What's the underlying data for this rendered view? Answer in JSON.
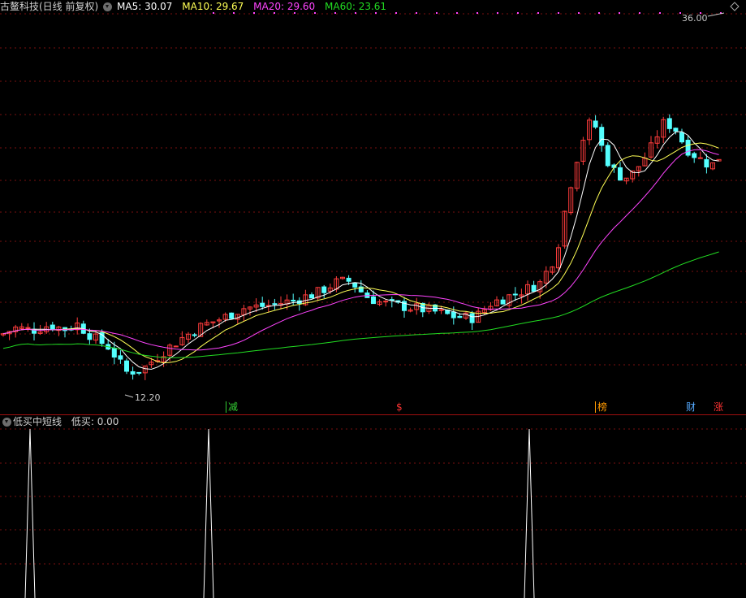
{
  "header": {
    "title": "古鳌科技(日线 前复权)",
    "ma": [
      {
        "label": "MA5: 30.07",
        "color": "#ffffff"
      },
      {
        "label": "MA10: 29.67",
        "color": "#ffff55"
      },
      {
        "label": "MA20: 29.60",
        "color": "#ff44ff"
      },
      {
        "label": "MA60: 23.61",
        "color": "#22dd22"
      }
    ]
  },
  "price_labels": {
    "high": "36.00",
    "low": "12.20"
  },
  "event_markers": [
    {
      "text": "减",
      "color": "#33cc33"
    },
    {
      "text": "$",
      "color": "#ff3333"
    },
    {
      "text": "榜",
      "color": "#ff9900"
    },
    {
      "text": "财",
      "color": "#55aaff"
    },
    {
      "text": "涨",
      "color": "#ff3333"
    }
  ],
  "indicator": {
    "title": "低买中短线",
    "value_label": "低买: 0.00"
  },
  "colors": {
    "up": "#ff3c3c",
    "down": "#54ffff",
    "grid": "#7a1010",
    "ma5": "#ffffff",
    "ma10": "#ffff55",
    "ma20": "#ff44ff",
    "ma60": "#22dd22"
  },
  "chart_data": {
    "type": "candlestick",
    "series": [
      {
        "name": "MA5",
        "last": 30.07
      },
      {
        "name": "MA10",
        "last": 29.67
      },
      {
        "name": "MA20",
        "last": 29.6
      },
      {
        "name": "MA60",
        "last": 23.61
      }
    ],
    "annotations": [
      "36.00",
      "12.20"
    ],
    "sub_indicator": {
      "name": "低买中短线",
      "value": 0.0,
      "spikes": 3
    }
  }
}
